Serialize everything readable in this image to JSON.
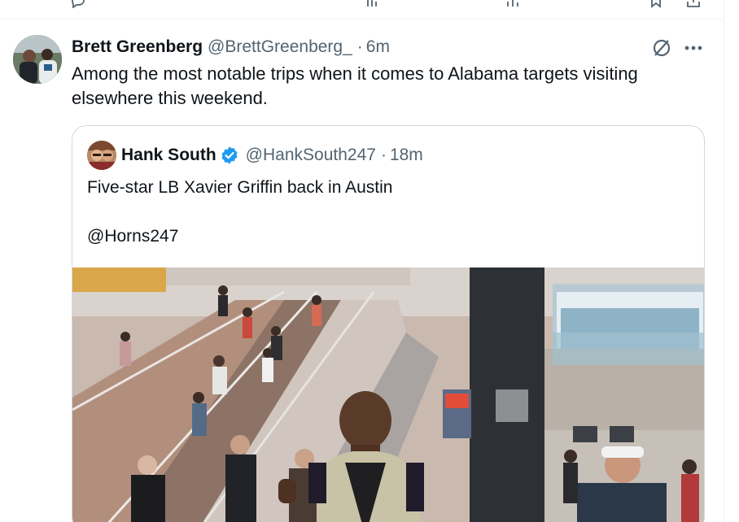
{
  "tweet": {
    "author_name": "Brett Greenberg",
    "author_handle": "@BrettGreenberg_",
    "separator": "·",
    "time": "6m",
    "text": "Among the most notable trips when it comes to Alabama targets visiting elsewhere this weekend.",
    "more_label": "···"
  },
  "quote": {
    "author_name": "Hank South",
    "author_handle": "@HankSouth247",
    "separator": "·",
    "time": "18m",
    "text_line1": "Five-star LB Xavier Griffin back in Austin",
    "text_line2": "@Horns247",
    "verified_color": "#1d9bf0"
  },
  "icons": {
    "grok": "grok-slash-circle-icon",
    "more": "more-horizontal-icon",
    "verified": "verified-badge-icon",
    "prev_actions": [
      "reply-icon",
      "repost-icon",
      "like-icon",
      "views-icon",
      "bookmark-icon",
      "share-icon"
    ]
  },
  "colors": {
    "text_primary": "#0f1419",
    "text_secondary": "#536471",
    "border": "#cfd9de",
    "accent": "#1d9bf0"
  }
}
